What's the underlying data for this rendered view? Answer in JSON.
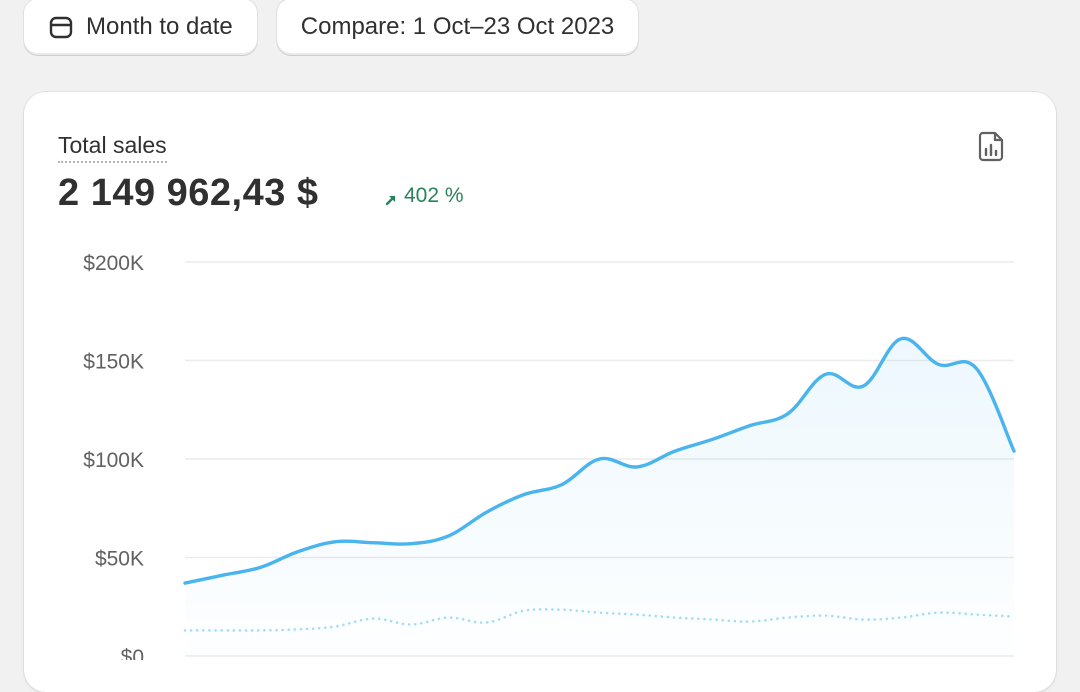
{
  "toolbar": {
    "date_range_label": "Month to date",
    "compare_label": "Compare: 1 Oct–23 Oct 2023"
  },
  "icons": {
    "calendar": "calendar-icon",
    "export": "chart-report-icon",
    "delta_arrow": "arrow-up-right-icon"
  },
  "metric": {
    "label": "Total sales",
    "value": "2 149 962,43 $",
    "delta": "402 %"
  },
  "colors": {
    "primary_series": "#4ab4ee",
    "comparison_series": "#a6dcf6",
    "delta_positive": "#29845a",
    "gridline": "#ebebeb"
  },
  "chart_data": {
    "type": "line",
    "title": "",
    "xlabel": "",
    "ylabel": "",
    "ylim": [
      0,
      200000
    ],
    "yticks": [
      "$0",
      "$50K",
      "$100K",
      "$150K",
      "$200K"
    ],
    "ytick_values": [
      0,
      50000,
      100000,
      150000,
      200000
    ],
    "grid": true,
    "series": [
      {
        "style": "solid",
        "color": "#4ab4ee",
        "values": [
          37000,
          41000,
          45000,
          53000,
          58000,
          57500,
          57000,
          61000,
          73000,
          82000,
          87000,
          100000,
          96000,
          104000,
          110000,
          117000,
          123000,
          143000,
          137000,
          161000,
          148000,
          146000,
          104000
        ]
      },
      {
        "style": "dotted",
        "color": "#a6dcf6",
        "values": [
          13000,
          13000,
          13000,
          13500,
          15000,
          19000,
          16000,
          19500,
          17000,
          23000,
          23500,
          22000,
          21000,
          19500,
          18500,
          17500,
          19500,
          20500,
          18500,
          19500,
          22000,
          21000,
          20000
        ]
      }
    ]
  }
}
